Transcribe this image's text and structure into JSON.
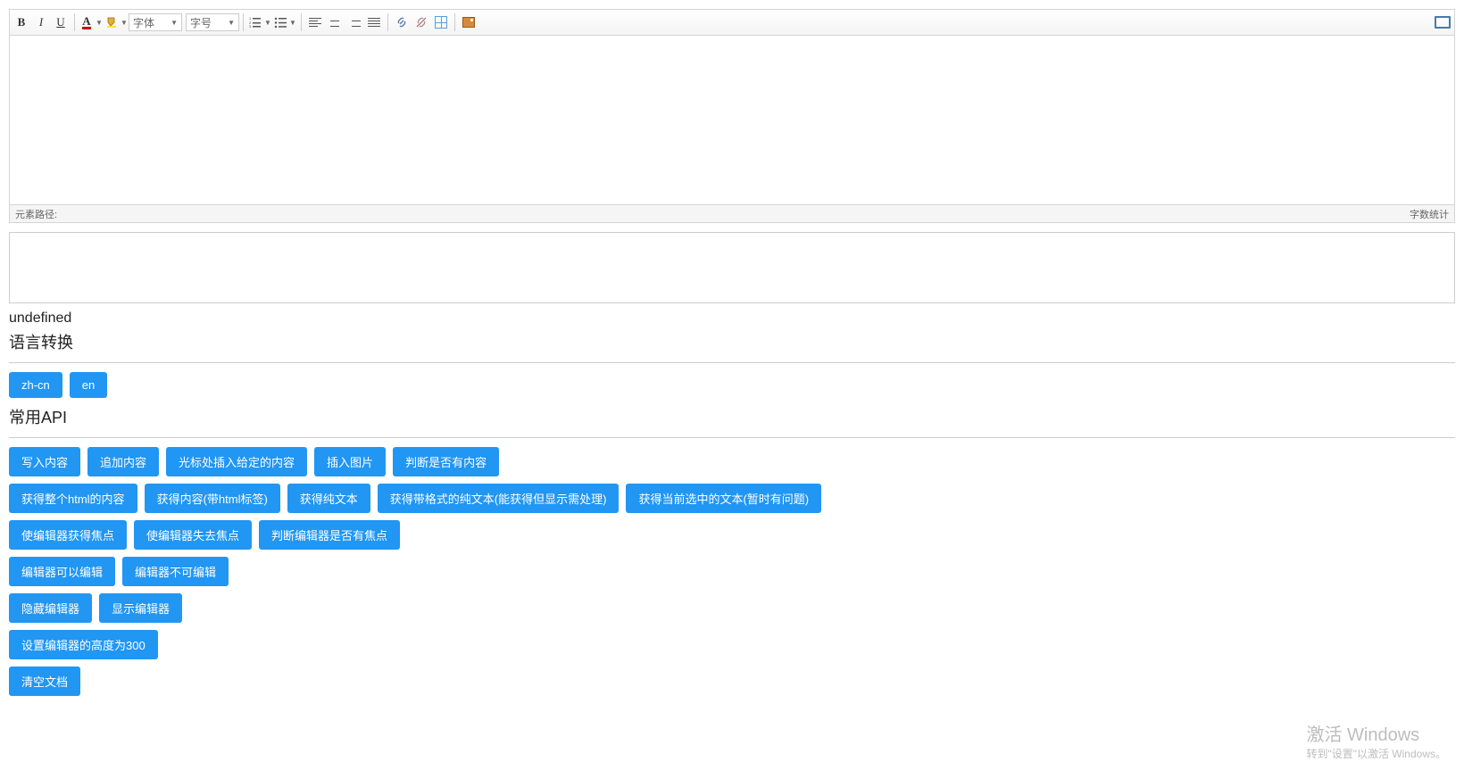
{
  "toolbar": {
    "bold": "B",
    "italic": "I",
    "underline": "U",
    "forecolor": "A",
    "font_label": "字体",
    "size_label": "字号"
  },
  "statusbar": {
    "left": "元素路径:",
    "right": "字数统计"
  },
  "undefined_text": "undefined",
  "lang_section": {
    "title": "语言转换",
    "buttons": [
      "zh-cn",
      "en"
    ]
  },
  "api_section": {
    "title": "常用API",
    "rows": [
      [
        "写入内容",
        "追加内容",
        "光标处插入给定的内容",
        "插入图片",
        "判断是否有内容"
      ],
      [
        "获得整个html的内容",
        "获得内容(带html标签)",
        "获得纯文本",
        "获得带格式的纯文本(能获得但显示需处理)",
        "获得当前选中的文本(暂时有问题)"
      ],
      [
        "使编辑器获得焦点",
        "使编辑器失去焦点",
        "判断编辑器是否有焦点"
      ],
      [
        "编辑器可以编辑",
        "编辑器不可编辑"
      ],
      [
        "隐藏编辑器",
        "显示编辑器"
      ],
      [
        "设置编辑器的高度为300"
      ],
      [
        "清空文档"
      ]
    ]
  },
  "watermark": {
    "title": "激活 Windows",
    "sub": "转到\"设置\"以激活 Windows。"
  }
}
